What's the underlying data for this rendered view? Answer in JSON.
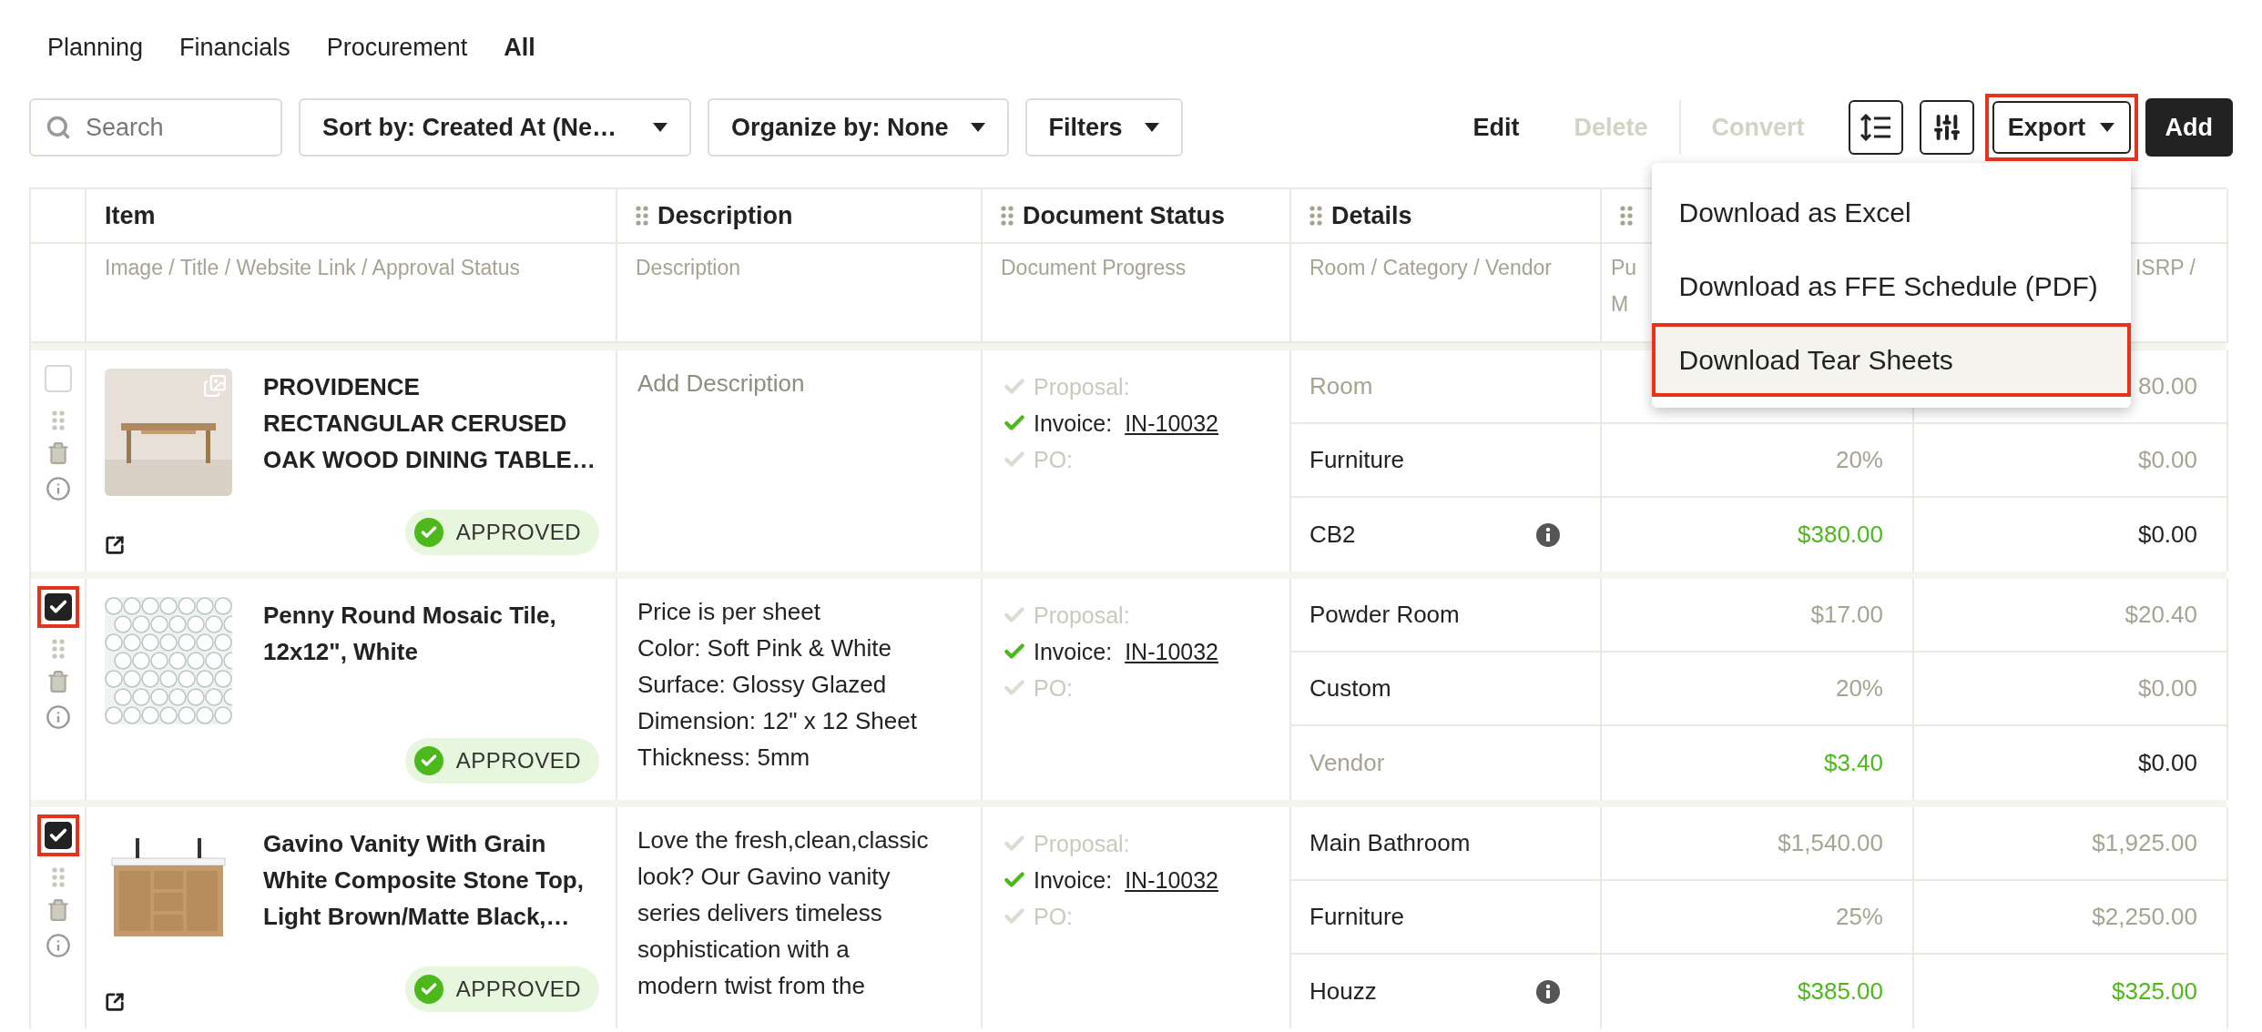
{
  "tabs": [
    {
      "label": "Planning",
      "selected": false
    },
    {
      "label": "Financials",
      "selected": false
    },
    {
      "label": "Procurement",
      "selected": false
    },
    {
      "label": "All",
      "selected": true
    }
  ],
  "toolbar": {
    "search": {
      "placeholder": "Search"
    },
    "dropdowns": [
      {
        "label": "Sort by: Created At (Ne…"
      },
      {
        "label": "Organize by: None"
      },
      {
        "label": "Filters"
      }
    ],
    "actions": [
      {
        "label": "Edit",
        "disabled": false
      },
      {
        "label": "Delete",
        "disabled": true
      },
      {
        "label": "Convert",
        "disabled": true
      }
    ],
    "export": {
      "label": "Export",
      "annotated": true,
      "expanded": true
    },
    "add": {
      "label": "Add"
    }
  },
  "export_menu": [
    {
      "label": "Download as Excel",
      "annotated": false
    },
    {
      "label": "Download as FFE Schedule (PDF)",
      "annotated": false
    },
    {
      "label": "Download Tear Sheets",
      "annotated": true
    }
  ],
  "columns": [
    {
      "title": "Item",
      "handle": false,
      "subtitle": [
        "Image / Title / Website Link / Approval Status"
      ]
    },
    {
      "title": "Description",
      "handle": true,
      "subtitle": [
        "Description"
      ]
    },
    {
      "title": "Document Status",
      "handle": true,
      "subtitle": [
        "Document Progress"
      ]
    },
    {
      "title": "Details",
      "handle": true,
      "subtitle": [
        "Room / Category / Vendor"
      ]
    },
    {
      "handle": true,
      "subtitle": [
        "Pu",
        "M"
      ]
    },
    {
      "handle": false,
      "subtitle": [
        "ISRP /"
      ]
    }
  ],
  "rows": [
    {
      "selected": false,
      "annotated": false,
      "title": "PROVIDENCE RECTANGULAR CERUSED OAK WOOD DINING TABLE…",
      "image_badge": true,
      "link_icon": true,
      "status": "APPROVED",
      "description": {
        "placeholder": "Add Description"
      },
      "documents": [
        {
          "label": "Proposal:",
          "done": false
        },
        {
          "label": "Invoice:",
          "link": "IN-10032",
          "done": true
        },
        {
          "label": "PO:",
          "done": false
        }
      ],
      "sub_rows": [
        {
          "detail": {
            "text": "Room",
            "placeholder": true,
            "info": false
          },
          "column_6": {
            "text": "80.00",
            "color": "#a6a491"
          }
        },
        {
          "detail": {
            "text": "Furniture",
            "placeholder": false,
            "info": false
          },
          "column_5": {
            "text": "20%",
            "color": "#a6a491"
          },
          "column_6": {
            "text": "$0.00",
            "color": "#a6a491"
          }
        },
        {
          "detail": {
            "text": "CB2",
            "placeholder": false,
            "info": true
          },
          "column_5": {
            "text": "$380.00",
            "color": "#4cb81c"
          },
          "column_6": {
            "text": "$0.00",
            "color": "#222222"
          }
        }
      ]
    },
    {
      "selected": true,
      "annotated": true,
      "title": "Penny Round Mosaic Tile, 12x12\", White",
      "image_badge": false,
      "link_icon": false,
      "status": "APPROVED",
      "description": {
        "lines": [
          "Price is per sheet",
          "Color: Soft Pink & White",
          "Surface: Glossy Glazed",
          "Dimension: 12\" x 12 Sheet",
          "Thickness: 5mm"
        ]
      },
      "documents": [
        {
          "label": "Proposal:",
          "done": false
        },
        {
          "label": "Invoice:",
          "link": "IN-10032",
          "done": true
        },
        {
          "label": "PO:",
          "done": false
        }
      ],
      "sub_rows": [
        {
          "detail": {
            "text": "Powder Room",
            "placeholder": false,
            "info": false
          },
          "column_5": {
            "text": "$17.00",
            "color": "#a6a491"
          },
          "column_6": {
            "text": "$20.40",
            "color": "#a6a491"
          }
        },
        {
          "detail": {
            "text": "Custom",
            "placeholder": false,
            "info": false
          },
          "column_5": {
            "text": "20%",
            "color": "#a6a491"
          },
          "column_6": {
            "text": "$0.00",
            "color": "#a6a491"
          }
        },
        {
          "detail": {
            "text": "Vendor",
            "placeholder": true,
            "info": false
          },
          "column_5": {
            "text": "$3.40",
            "color": "#4cb81c"
          },
          "column_6": {
            "text": "$0.00",
            "color": "#222222"
          }
        }
      ]
    },
    {
      "selected": true,
      "annotated": true,
      "title": "Gavino Vanity With Grain White Composite Stone Top, Light Brown/Matte Black,…",
      "image_badge": false,
      "link_icon": true,
      "status": "APPROVED",
      "description": {
        "lines": [
          "Love the fresh,clean,classic",
          "look? Our Gavino vanity",
          "series delivers timeless",
          "sophistication with a",
          "modern twist from the"
        ]
      },
      "documents": [
        {
          "label": "Proposal:",
          "done": false
        },
        {
          "label": "Invoice:",
          "link": "IN-10032",
          "done": true
        },
        {
          "label": "PO:",
          "done": false
        }
      ],
      "sub_rows": [
        {
          "detail": {
            "text": "Main Bathroom",
            "placeholder": false,
            "info": false
          },
          "column_5": {
            "text": "$1,540.00",
            "color": "#a6a491"
          },
          "column_6": {
            "text": "$1,925.00",
            "color": "#a6a491"
          }
        },
        {
          "detail": {
            "text": "Furniture",
            "placeholder": false,
            "info": false
          },
          "column_5": {
            "text": "25%",
            "color": "#a6a491"
          },
          "column_6": {
            "text": "$2,250.00",
            "color": "#a6a491"
          }
        },
        {
          "detail": {
            "text": "Houzz",
            "placeholder": false,
            "info": true
          },
          "column_5": {
            "text": "$385.00",
            "color": "#4cb81c"
          },
          "column_6": {
            "text": "$325.00",
            "color": "#4cb81c"
          }
        }
      ]
    }
  ]
}
